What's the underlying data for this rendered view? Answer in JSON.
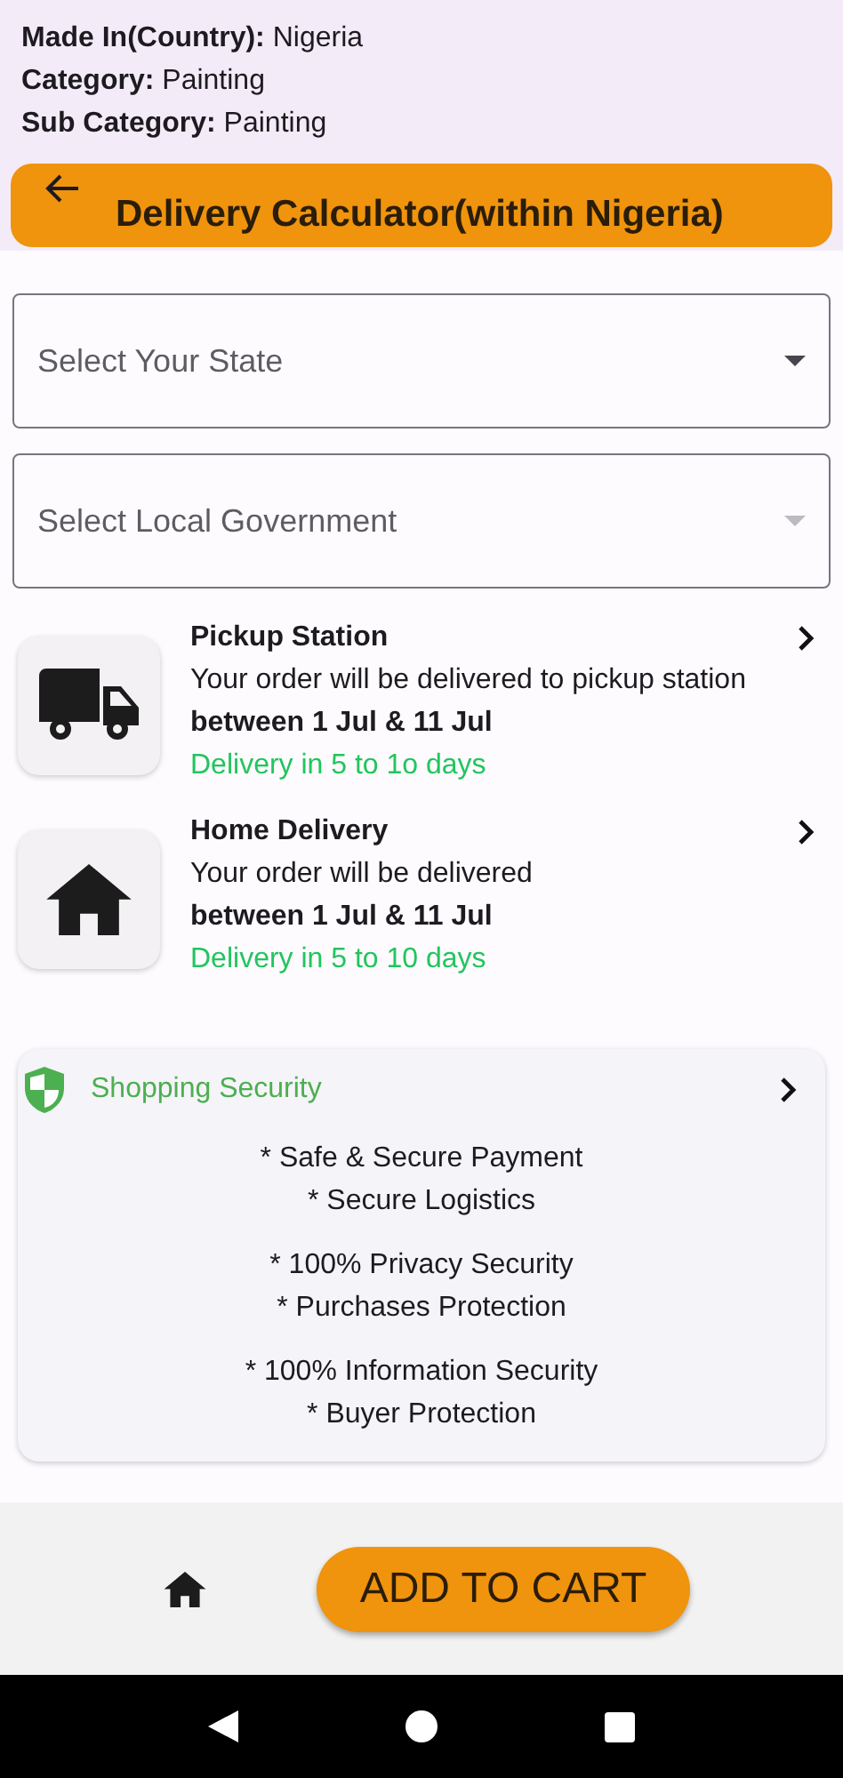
{
  "details": [
    {
      "label": "Made In(Country):",
      "value": "Nigeria"
    },
    {
      "label": "Category:",
      "value": "Painting"
    },
    {
      "label": "Sub Category:",
      "value": "Painting"
    }
  ],
  "header": {
    "title": "Delivery Calculator(within Nigeria)"
  },
  "dropdowns": [
    {
      "placeholder": "Select Your State",
      "disabled": false
    },
    {
      "placeholder": "Select Local Government",
      "disabled": true
    }
  ],
  "delivery_options": [
    {
      "kind": "truck",
      "title": "Pickup Station",
      "description": "Your order will be delivered to pickup station",
      "dates": "between 1 Jul & 11 Jul",
      "eta": "Delivery in 5 to 1o days"
    },
    {
      "kind": "home",
      "title": "Home Delivery",
      "description": "Your order will be delivered",
      "dates": "between 1 Jul & 11 Jul",
      "eta": "Delivery in 5 to 10 days"
    }
  ],
  "security": {
    "title": "Shopping Security",
    "groups": [
      [
        "* Safe & Secure Payment",
        "* Secure Logistics"
      ],
      [
        "* 100% Privacy Security",
        "* Purchases Protection"
      ],
      [
        "* 100% Information Security",
        "* Buyer Protection"
      ]
    ]
  },
  "bottom_bar": {
    "button": "ADD TO CART"
  }
}
